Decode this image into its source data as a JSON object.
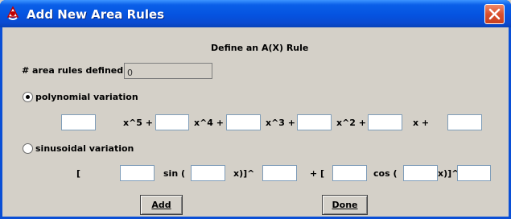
{
  "window": {
    "title": "Add New Area Rules",
    "icon": "app-icon",
    "close_icon": "close-icon"
  },
  "form": {
    "heading": "Define an A(X) Rule",
    "count_label": "# area rules defined",
    "count_value": "0",
    "polynomial": {
      "label": "polynomial variation",
      "selected": true,
      "terms": [
        "x^5 +",
        "x^4 +",
        "x^3 +",
        "x^2 +",
        "x +"
      ],
      "values": [
        "",
        "",
        "",
        "",
        "",
        ""
      ]
    },
    "sinusoidal": {
      "label": "sinusoidal variation",
      "selected": false,
      "open_bracket": "[",
      "sin_label": "sin (",
      "x_pow_1": "x)]^",
      "plus_bracket": "+ [",
      "cos_label": "cos (",
      "x_pow_2": "x)]^",
      "values": [
        "",
        "",
        "",
        "",
        "",
        ""
      ]
    }
  },
  "buttons": {
    "add_label": "Add",
    "done_label": "Done"
  },
  "colors": {
    "titlebar": "#0553e0",
    "client_bg": "#d4d0c8",
    "close_button": "#d9502e"
  }
}
